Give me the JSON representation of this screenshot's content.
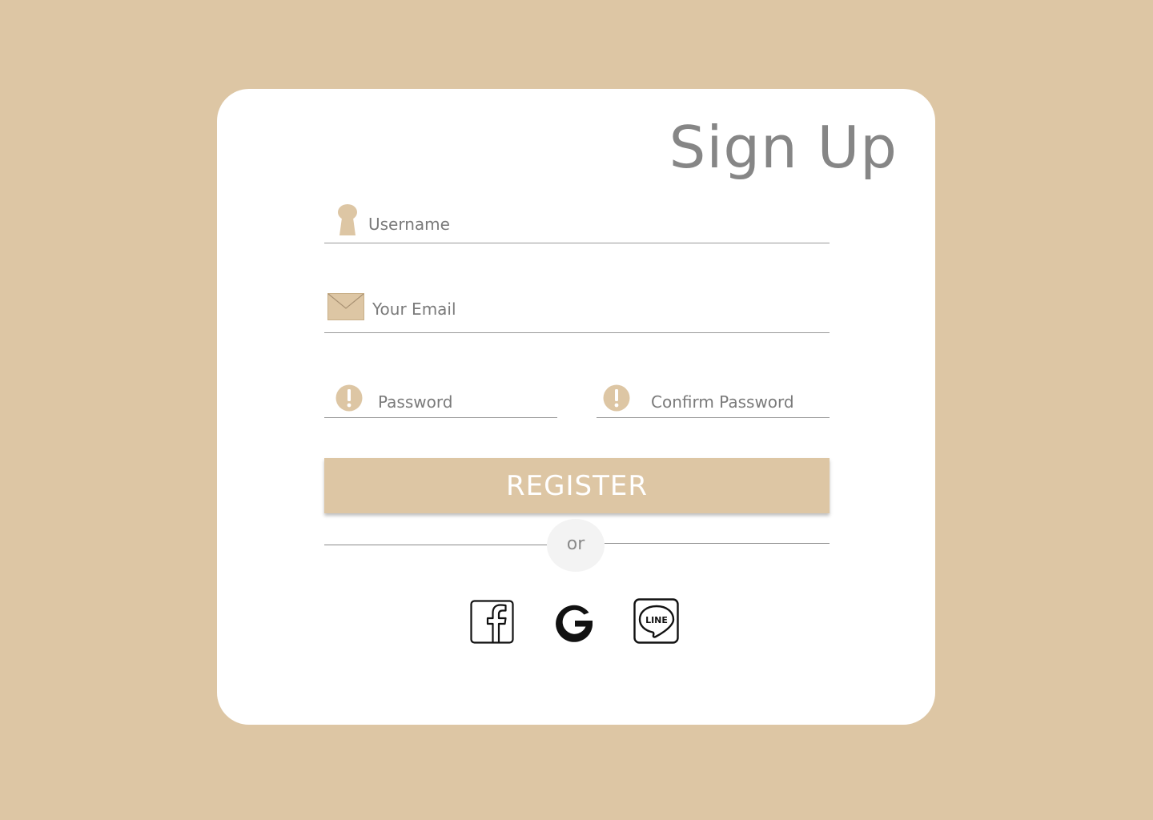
{
  "page": {
    "title": "Sign Up"
  },
  "form": {
    "username": {
      "placeholder": "Username",
      "icon": "user-icon"
    },
    "email": {
      "placeholder": "Your Email",
      "icon": "envelope-icon"
    },
    "password": {
      "placeholder": "Password",
      "icon": "alert-icon"
    },
    "confirm_password": {
      "placeholder": "Confirm Password",
      "icon": "alert-icon"
    },
    "register_label": "REGISTER"
  },
  "divider": {
    "label": "or"
  },
  "social": {
    "items": [
      {
        "name": "facebook",
        "icon": "facebook-icon"
      },
      {
        "name": "google",
        "icon": "google-icon"
      },
      {
        "name": "line",
        "icon": "line-icon"
      }
    ]
  },
  "colors": {
    "background": "#DDC6A4",
    "accent": "#DDC6A4",
    "card": "#FFFFFF",
    "title_text": "#868686"
  }
}
